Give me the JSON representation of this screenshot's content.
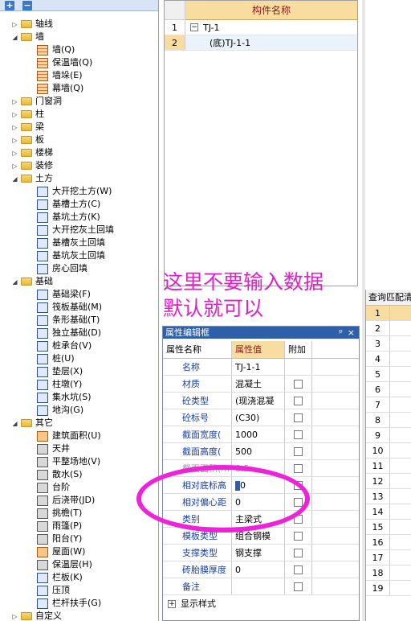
{
  "tree": {
    "items": [
      {
        "label": "轴线",
        "exp": "▷",
        "kind": "folder",
        "indent": 0
      },
      {
        "label": "墙",
        "exp": "◢",
        "kind": "folder",
        "indent": 0
      },
      {
        "label": "墙(Q)",
        "kind": "brick",
        "indent": 1
      },
      {
        "label": "保温墙(Q)",
        "kind": "brick",
        "indent": 1
      },
      {
        "label": "墙垛(E)",
        "kind": "brick",
        "indent": 1
      },
      {
        "label": "幕墙(Q)",
        "kind": "brick",
        "indent": 1
      },
      {
        "label": "门窗洞",
        "exp": "▷",
        "kind": "folder",
        "indent": 0
      },
      {
        "label": "柱",
        "exp": "▷",
        "kind": "folder",
        "indent": 0
      },
      {
        "label": "梁",
        "exp": "▷",
        "kind": "folder",
        "indent": 0
      },
      {
        "label": "板",
        "exp": "▷",
        "kind": "folder",
        "indent": 0
      },
      {
        "label": "楼梯",
        "exp": "▷",
        "kind": "folder",
        "indent": 0
      },
      {
        "label": "装修",
        "exp": "▷",
        "kind": "folder",
        "indent": 0
      },
      {
        "label": "土方",
        "exp": "◢",
        "kind": "folder",
        "indent": 0
      },
      {
        "label": "大开挖土方(W)",
        "kind": "blue",
        "indent": 1
      },
      {
        "label": "基槽土方(C)",
        "kind": "blue",
        "indent": 1
      },
      {
        "label": "基坑土方(K)",
        "kind": "blue",
        "indent": 1
      },
      {
        "label": "大开挖灰土回填",
        "kind": "blue",
        "indent": 1
      },
      {
        "label": "基槽灰土回填",
        "kind": "blue",
        "indent": 1
      },
      {
        "label": "基坑灰土回填",
        "kind": "blue",
        "indent": 1
      },
      {
        "label": "房心回填",
        "kind": "blue",
        "indent": 1
      },
      {
        "label": "基础",
        "exp": "◢",
        "kind": "folder",
        "indent": 0
      },
      {
        "label": "基础梁(F)",
        "kind": "blue",
        "indent": 1
      },
      {
        "label": "筏板基础(M)",
        "kind": "blue",
        "indent": 1
      },
      {
        "label": "条形基础(T)",
        "kind": "blue",
        "indent": 1
      },
      {
        "label": "独立基础(D)",
        "kind": "blue",
        "indent": 1
      },
      {
        "label": "桩承台(V)",
        "kind": "blue",
        "indent": 1
      },
      {
        "label": "桩(U)",
        "kind": "blue",
        "indent": 1
      },
      {
        "label": "垫层(X)",
        "kind": "blue",
        "indent": 1
      },
      {
        "label": "柱墩(Y)",
        "kind": "blue",
        "indent": 1
      },
      {
        "label": "集水坑(S)",
        "kind": "blue",
        "indent": 1
      },
      {
        "label": "地沟(G)",
        "kind": "blue",
        "indent": 1
      },
      {
        "label": "其它",
        "exp": "◢",
        "kind": "folder",
        "indent": 0
      },
      {
        "label": "建筑面积(U)",
        "kind": "orange",
        "indent": 1
      },
      {
        "label": "天井",
        "kind": "gray",
        "indent": 1
      },
      {
        "label": "平整场地(V)",
        "kind": "gray",
        "indent": 1
      },
      {
        "label": "散水(S)",
        "kind": "gray",
        "indent": 1
      },
      {
        "label": "台阶",
        "kind": "gray",
        "indent": 1
      },
      {
        "label": "后浇带(JD)",
        "kind": "gray",
        "indent": 1
      },
      {
        "label": "挑檐(T)",
        "kind": "gray",
        "indent": 1
      },
      {
        "label": "雨篷(P)",
        "kind": "gray",
        "indent": 1
      },
      {
        "label": "阳台(Y)",
        "kind": "gray",
        "indent": 1
      },
      {
        "label": "屋面(W)",
        "kind": "orange",
        "indent": 1
      },
      {
        "label": "保温层(H)",
        "kind": "gray",
        "indent": 1
      },
      {
        "label": "栏板(K)",
        "kind": "blue",
        "indent": 1
      },
      {
        "label": "压顶",
        "kind": "blue",
        "indent": 1
      },
      {
        "label": "栏杆扶手(G)",
        "kind": "blue",
        "indent": 1
      },
      {
        "label": "自定义",
        "exp": "▷",
        "kind": "folder",
        "indent": 0
      }
    ]
  },
  "grid": {
    "column_header": "构件名称",
    "rows": [
      {
        "num": "1",
        "name": "TJ-1"
      },
      {
        "num": "2",
        "name": "(底)TJ-1-1"
      }
    ]
  },
  "annotation": {
    "line1": "这里不要输入数据",
    "line2": "默认就可以"
  },
  "prop": {
    "title": "属性编辑框",
    "pin": "ᵖ",
    "close": "×",
    "headers": {
      "name": "属性名称",
      "value": "属性值",
      "extra": "附加"
    },
    "rows": [
      {
        "name": "名称",
        "value": "TJ-1-1",
        "checkbox": false
      },
      {
        "name": "材质",
        "value": "混凝土",
        "checkbox": true
      },
      {
        "name": "砼类型",
        "value": "(现浇混凝",
        "checkbox": true
      },
      {
        "name": "砼标号",
        "value": "(C30)",
        "checkbox": true
      },
      {
        "name": "截面宽度(",
        "value": "1000",
        "checkbox": true
      },
      {
        "name": "截面高度(",
        "value": "500",
        "checkbox": true
      },
      {
        "name": "截面面积(m",
        "value": "0.5",
        "checkbox": true,
        "dim": true
      },
      {
        "name": "相对底标高",
        "value": "0",
        "checkbox": true,
        "editing": true
      },
      {
        "name": "相对偏心距",
        "value": "0",
        "checkbox": true
      },
      {
        "name": "类别",
        "value": "主梁式",
        "checkbox": true
      },
      {
        "name": "模板类型",
        "value": "组合钢模",
        "checkbox": true
      },
      {
        "name": "支撑类型",
        "value": "钢支撑",
        "checkbox": true
      },
      {
        "name": "砖胎膜厚度",
        "value": "0",
        "checkbox": true
      },
      {
        "name": "备注",
        "value": "",
        "checkbox": true
      }
    ],
    "footer": "显示样式"
  },
  "right": {
    "title": "查询匹配清",
    "rows": [
      "1",
      "2",
      "3",
      "4",
      "5",
      "6",
      "7",
      "8",
      "9",
      "10",
      "11",
      "12",
      "13",
      "14",
      "15",
      "16",
      "17",
      "18",
      "19"
    ]
  }
}
